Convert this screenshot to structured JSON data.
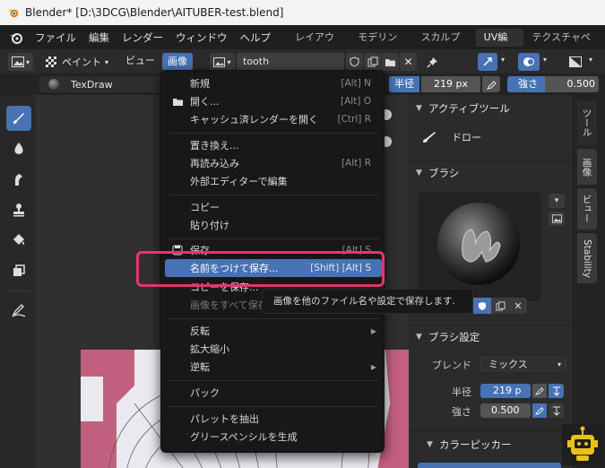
{
  "window": {
    "title": "Blender* [D:\\3DCG\\Blender\\AITUBER-test.blend]"
  },
  "menubar": {
    "items": [
      "ファイル",
      "編集",
      "レンダー",
      "ウィンドウ",
      "ヘルプ"
    ],
    "workspaces": [
      "レイアウト",
      "モデリング",
      "スカルプト",
      "UV編集",
      "テクスチャペイ"
    ],
    "active_workspace": "UV編集"
  },
  "header": {
    "mode": "ペイント",
    "view": "ビュー",
    "image": "画像",
    "image_name": "tooth"
  },
  "toolrow": {
    "brush_name": "TexDraw",
    "radius_label": "半径",
    "radius_value": "219 px",
    "strength_label": "強さ",
    "strength_value": "0.500"
  },
  "image_menu": {
    "items": [
      {
        "label": "新規",
        "shortcut": "[Alt] N"
      },
      {
        "label": "開く...",
        "shortcut": "[Alt] O"
      },
      {
        "label": "キャッシュ済レンダーを開く",
        "shortcut": "[Ctrl] R"
      },
      {
        "label": "置き換え...",
        "shortcut": ""
      },
      {
        "label": "再読み込み",
        "shortcut": "[Alt] R"
      },
      {
        "label": "外部エディターで編集",
        "shortcut": ""
      },
      {
        "label": "コピー",
        "shortcut": ""
      },
      {
        "label": "貼り付け",
        "shortcut": ""
      },
      {
        "label": "保存",
        "shortcut": "[Alt] S"
      },
      {
        "label": "名前をつけて保存...",
        "shortcut": "[Shift] [Alt] S"
      },
      {
        "label": "コピーを保存...",
        "shortcut": ""
      },
      {
        "label": "画像をすべて保存",
        "shortcut": ""
      },
      {
        "label": "反転",
        "shortcut": ""
      },
      {
        "label": "拡大縮小",
        "shortcut": ""
      },
      {
        "label": "逆転",
        "shortcut": ""
      },
      {
        "label": "パック",
        "shortcut": ""
      },
      {
        "label": "パレットを抽出",
        "shortcut": ""
      },
      {
        "label": "グリースペンシルを生成",
        "shortcut": ""
      }
    ]
  },
  "tooltip": "画像を他のファイル名や設定で保存します.",
  "panel": {
    "active_tool": {
      "title": "アクティブツール",
      "tool": "ドロー"
    },
    "brush": {
      "title": "ブラシ"
    },
    "brush_settings": {
      "title": "ブラシ設定",
      "blend_label": "ブレンド",
      "blend_value": "ミックス",
      "radius_label": "半径",
      "radius_value": "219 p",
      "strength_label": "強さ",
      "strength_value": "0.500"
    },
    "color_picker": {
      "title": "カラーピッカー"
    }
  },
  "side_tabs": [
    "ツール",
    "画像",
    "ビュー",
    "Stability"
  ],
  "colors": {
    "accent": "#4772b3",
    "highlight_box": "#e8336b",
    "texture_pink": "#c2607f"
  }
}
